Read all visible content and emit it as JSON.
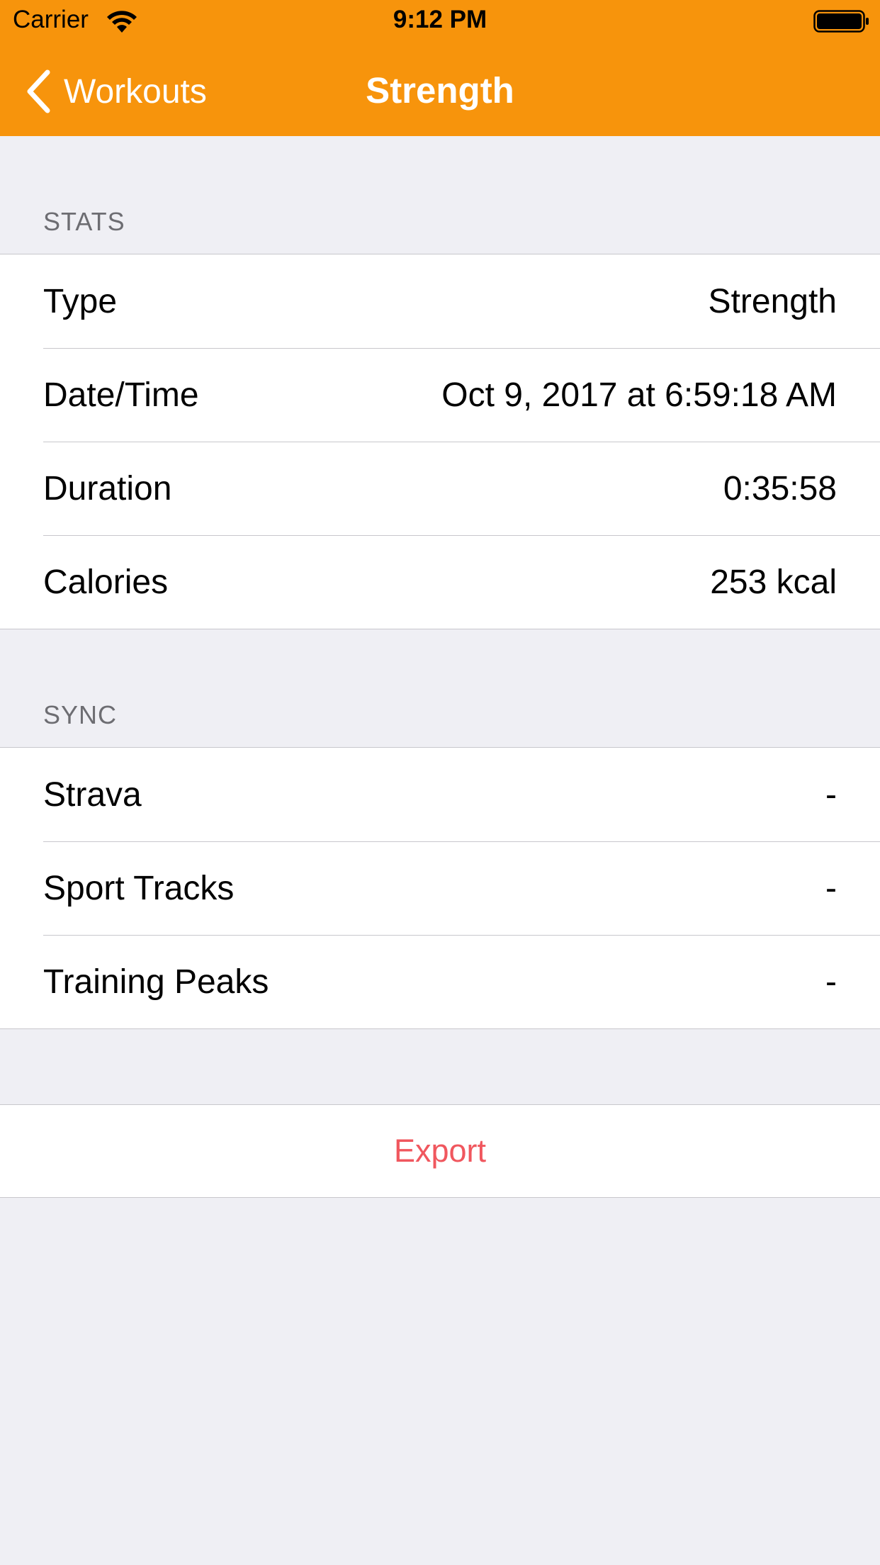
{
  "status_bar": {
    "carrier": "Carrier",
    "time": "9:12 PM",
    "wifi_icon": "wifi-icon",
    "battery_icon": "battery-icon"
  },
  "nav": {
    "back_label": "Workouts",
    "back_icon": "chevron-left-icon",
    "title": "Strength",
    "bar_color": "#f7940c"
  },
  "stats": {
    "header": "STATS",
    "rows": [
      {
        "label": "Type",
        "value": "Strength"
      },
      {
        "label": "Date/Time",
        "value": "Oct 9, 2017 at 6:59:18 AM"
      },
      {
        "label": "Duration",
        "value": "0:35:58"
      },
      {
        "label": "Calories",
        "value": "253 kcal"
      }
    ]
  },
  "sync": {
    "header": "SYNC",
    "rows": [
      {
        "label": "Strava",
        "value": "-"
      },
      {
        "label": "Sport Tracks",
        "value": "-"
      },
      {
        "label": "Training Peaks",
        "value": "-"
      }
    ]
  },
  "actions": {
    "export_label": "Export",
    "export_color": "#f0575e"
  }
}
